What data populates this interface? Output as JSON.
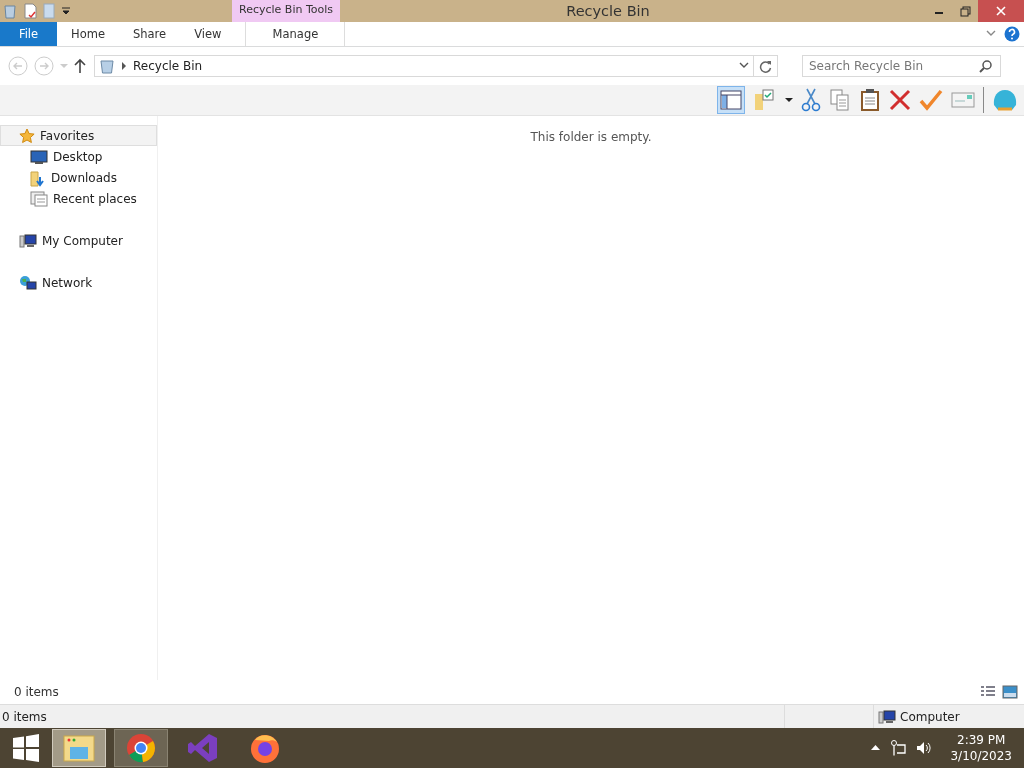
{
  "window": {
    "title": "Recycle Bin",
    "context_group": "Recycle Bin Tools"
  },
  "ribbon_tabs": [
    {
      "label": "File",
      "kind": "file",
      "selected": false
    },
    {
      "label": "Home",
      "kind": "tab",
      "selected": false
    },
    {
      "label": "Share",
      "kind": "tab",
      "selected": false
    },
    {
      "label": "View",
      "kind": "tab",
      "selected": false
    },
    {
      "label": "Manage",
      "kind": "context",
      "selected": false
    }
  ],
  "address": {
    "path": "Recycle Bin"
  },
  "search": {
    "placeholder": "Search Recycle Bin"
  },
  "navigation": [
    {
      "label": "Favorites",
      "selected": true,
      "children": [
        {
          "label": "Desktop",
          "selected": false
        },
        {
          "label": "Downloads",
          "selected": false
        },
        {
          "label": "Recent places",
          "selected": false
        }
      ]
    },
    {
      "label": "My Computer",
      "selected": false
    },
    {
      "label": "Network",
      "selected": false
    }
  ],
  "content": {
    "empty_message": "This folder is empty."
  },
  "status_bar": {
    "item_count": "0 items"
  },
  "details_bar": {
    "item_count": "0 items",
    "location": "Computer"
  },
  "taskbar": {
    "apps": [
      {
        "running": true,
        "selected": true
      },
      {
        "running": true,
        "selected": false
      },
      {
        "running": false,
        "selected": false
      },
      {
        "running": false,
        "selected": false
      }
    ],
    "clock": {
      "time": "2:39 PM",
      "date": "3/10/2023"
    }
  }
}
